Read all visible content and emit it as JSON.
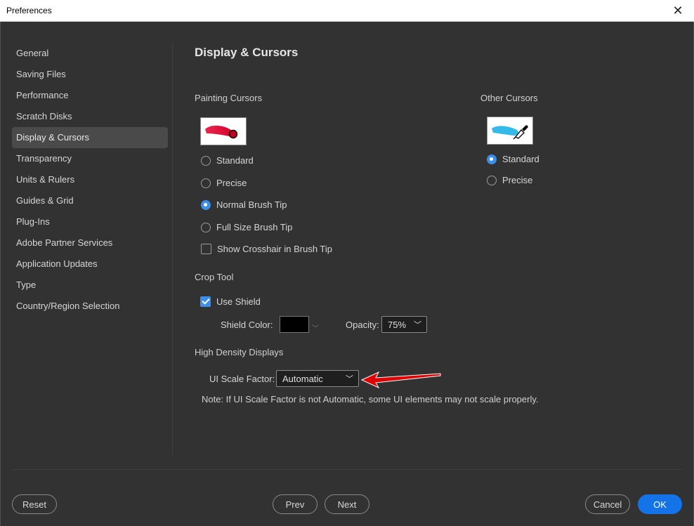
{
  "window": {
    "title": "Preferences",
    "close_glyph": "✕"
  },
  "sidebar": {
    "items": [
      {
        "label": "General"
      },
      {
        "label": "Saving Files"
      },
      {
        "label": "Performance"
      },
      {
        "label": "Scratch Disks"
      },
      {
        "label": "Display & Cursors",
        "active": true
      },
      {
        "label": "Transparency"
      },
      {
        "label": "Units & Rulers"
      },
      {
        "label": "Guides & Grid"
      },
      {
        "label": "Plug-Ins"
      },
      {
        "label": "Adobe Partner Services"
      },
      {
        "label": "Application Updates"
      },
      {
        "label": "Type"
      },
      {
        "label": "Country/Region Selection"
      }
    ]
  },
  "main": {
    "title": "Display & Cursors",
    "painting_cursors": {
      "heading": "Painting Cursors",
      "preview_icon": "red-brush-stroke-icon",
      "options": [
        {
          "label": "Standard",
          "checked": false
        },
        {
          "label": "Precise",
          "checked": false
        },
        {
          "label": "Normal Brush Tip",
          "checked": true
        },
        {
          "label": "Full Size Brush Tip",
          "checked": false
        }
      ],
      "crosshair": {
        "label": "Show Crosshair in Brush Tip",
        "checked": false
      }
    },
    "other_cursors": {
      "heading": "Other Cursors",
      "preview_icon": "eyedropper-icon",
      "options": [
        {
          "label": "Standard",
          "checked": true
        },
        {
          "label": "Precise",
          "checked": false
        }
      ]
    },
    "crop_tool": {
      "heading": "Crop Tool",
      "use_shield": {
        "label": "Use Shield",
        "checked": true
      },
      "shield_color_label": "Shield Color:",
      "shield_color": "#000000",
      "opacity_label": "Opacity:",
      "opacity_value": "75%"
    },
    "high_density": {
      "heading": "High Density Displays",
      "scale_label": "UI Scale Factor:",
      "scale_value": "Automatic",
      "note": "Note: If UI Scale Factor is not Automatic, some UI elements may not scale properly."
    }
  },
  "footer": {
    "reset": "Reset",
    "prev": "Prev",
    "next": "Next",
    "cancel": "Cancel",
    "ok": "OK"
  },
  "colors": {
    "accent": "#1473e6",
    "annotation_arrow": "#e00000"
  }
}
